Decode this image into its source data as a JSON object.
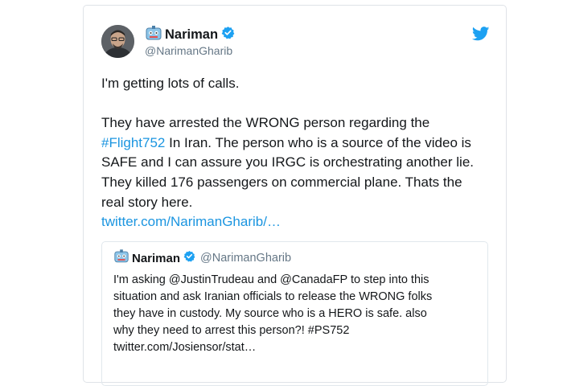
{
  "tweet": {
    "author": {
      "display_name": "Nariman",
      "handle": "@NarimanGharib"
    },
    "text_intro": "I'm getting lots of calls.",
    "body_before_hashtag": "They have arrested the WRONG person regarding the ",
    "hashtag": "#Flight752",
    "body_after_hashtag": " In Iran. The person who is a source of the video is SAFE and I can assure you IRGC is orchestrating another lie. They killed 176 passengers on commercial plane. Thats the real story here.",
    "link": "twitter.com/NarimanGharib/…"
  },
  "quoted_tweet": {
    "author": {
      "display_name": "Nariman",
      "handle": "@NarimanGharib"
    },
    "text_part1": "I'm asking  @JustinTrudeau   and @CanadaFP  to step into this",
    "text_part2": "situation and ask Iranian officials to release the WRONG folks",
    "text_part3": "they have in custody. My source who is a HERO is safe. also",
    "text_part4": "why they need to arrest this person?! #PS752",
    "link": "twitter.com/Josiensor/stat…"
  },
  "icons": {
    "verified": "verified-badge-icon",
    "bird": "twitter-bird-icon",
    "emoji": "robot-face-emoji-icon"
  },
  "colors": {
    "link": "#1b95e0",
    "verified": "#1da1f2",
    "text": "#14171a",
    "secondary": "#657786"
  }
}
